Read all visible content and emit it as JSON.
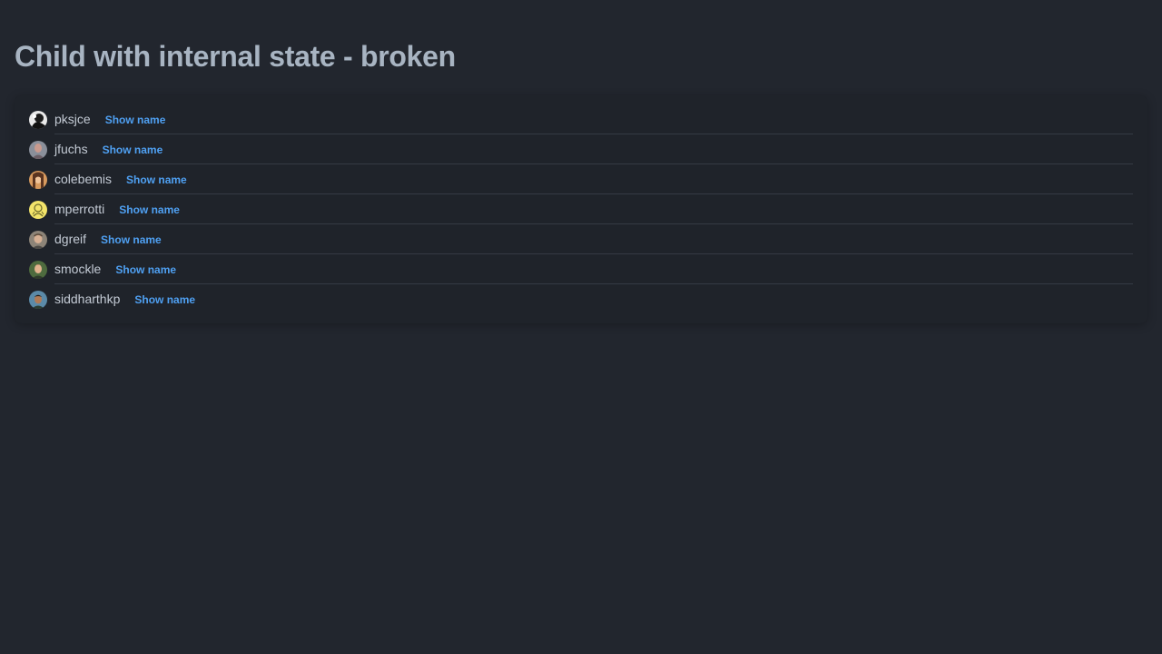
{
  "page": {
    "title": "Child with internal state - broken"
  },
  "colors": {
    "background": "#22262e",
    "card": "#1f232a",
    "title": "#a8b4c2",
    "username": "#c3cad4",
    "link": "#4fa0f2",
    "divider": "#353a44"
  },
  "users": [
    {
      "username": "pksjce",
      "action_label": "Show name",
      "avatar_icon": "user-avatar-icon"
    },
    {
      "username": "jfuchs",
      "action_label": "Show name",
      "avatar_icon": "user-avatar-icon"
    },
    {
      "username": "colebemis",
      "action_label": "Show name",
      "avatar_icon": "user-avatar-icon"
    },
    {
      "username": "mperrotti",
      "action_label": "Show name",
      "avatar_icon": "user-avatar-icon"
    },
    {
      "username": "dgreif",
      "action_label": "Show name",
      "avatar_icon": "user-avatar-icon"
    },
    {
      "username": "smockle",
      "action_label": "Show name",
      "avatar_icon": "user-avatar-icon"
    },
    {
      "username": "siddharthkp",
      "action_label": "Show name",
      "avatar_icon": "user-avatar-icon"
    }
  ]
}
